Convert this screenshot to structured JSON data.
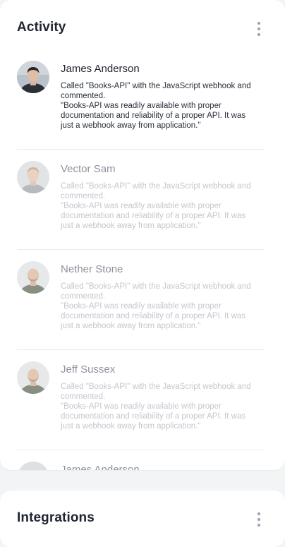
{
  "activity": {
    "title": "Activity",
    "items": [
      {
        "name": "James Anderson",
        "line1": "Called \"Books-API\" with the JavaScript webhook and commented.",
        "line2": "\"Books-API was readily available with proper documentation and reliability of a proper API. It was just a webhook away from application.\""
      },
      {
        "name": "Vector Sam",
        "line1": "Called \"Books-API\" with the JavaScript webhook and commented.",
        "line2": "\"Books-API was readily available with proper documentation and reliability of a proper API. It was just a webhook away from application.\""
      },
      {
        "name": "Nether Stone",
        "line1": "Called \"Books-API\" with the JavaScript webhook and commented.",
        "line2": "\"Books-API was readily available with proper documentation and reliability of a proper API. It was just a webhook away from application.\""
      },
      {
        "name": "Jeff Sussex",
        "line1": "Called \"Books-API\" with the JavaScript webhook and commented.",
        "line2": "\"Books-API was readily available with proper documentation and reliability of a proper API. It was just a webhook away from application.\""
      },
      {
        "name": "James Anderson"
      }
    ]
  },
  "integrations": {
    "title": "Integrations"
  },
  "icons": {
    "menu": "more-vertical-icon"
  },
  "colors": {
    "title": "#1f2430",
    "faded_text": "#c4c7cd",
    "divider": "#e9ebef"
  }
}
